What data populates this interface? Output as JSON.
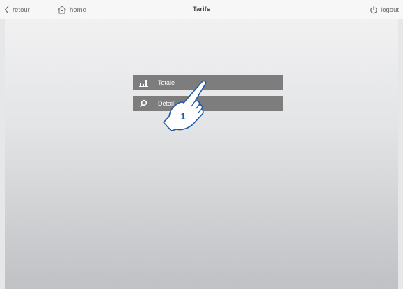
{
  "header": {
    "back_label": "retour",
    "home_label": "home",
    "title": "Tarifs",
    "logout_label": "logout"
  },
  "menu": {
    "items": [
      {
        "label": "Totale",
        "icon": "bar-chart-icon"
      },
      {
        "label": "Détail",
        "icon": "search-icon"
      }
    ]
  },
  "annotation": {
    "step_number": "1"
  },
  "colors": {
    "menu_item_bg": "#7d7d7d",
    "topbar_bg": "#f7f7f7",
    "hand_outline": "#1e5aa8"
  }
}
